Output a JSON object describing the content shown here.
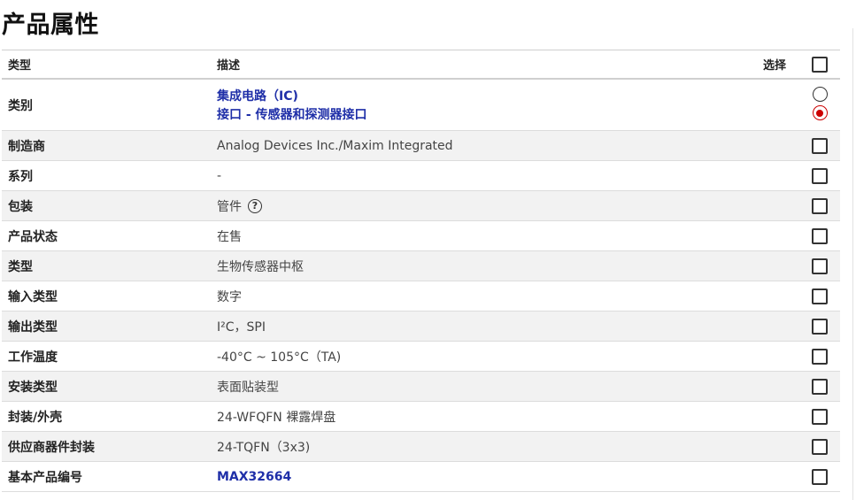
{
  "page": {
    "title": "产品属性"
  },
  "header": {
    "type": "类型",
    "description": "描述",
    "select": "选择"
  },
  "rows": [
    {
      "type": "类别",
      "links": [
        "集成电路（IC)",
        "接口 - 传感器和探测器接口"
      ],
      "selection": "radio",
      "selected_index": 1
    },
    {
      "type": "制造商",
      "description": "Analog Devices Inc./Maxim Integrated"
    },
    {
      "type": "系列",
      "description": "-"
    },
    {
      "type": "包装",
      "description": "管件",
      "help_icon": "question-circle-icon"
    },
    {
      "type": "产品状态",
      "description": "在售"
    },
    {
      "type": "类型",
      "description": "生物传感器中枢"
    },
    {
      "type": "输入类型",
      "description": "数字"
    },
    {
      "type": "输出类型",
      "description": "I²C，SPI"
    },
    {
      "type": "工作温度",
      "description": "-40°C ~ 105°C（TA)"
    },
    {
      "type": "安装类型",
      "description": "表面贴装型"
    },
    {
      "type": "封装/外壳",
      "description": "24-WFQFN 裸露焊盘"
    },
    {
      "type": "供应商器件封装",
      "description": "24-TQFN（3x3)"
    },
    {
      "type": "基本产品编号",
      "description": "MAX32664",
      "is_link": true
    }
  ],
  "colors": {
    "link": "#1f2fa8",
    "radio_selected": "#cc0000",
    "row_alt": "#f2f2f2"
  }
}
